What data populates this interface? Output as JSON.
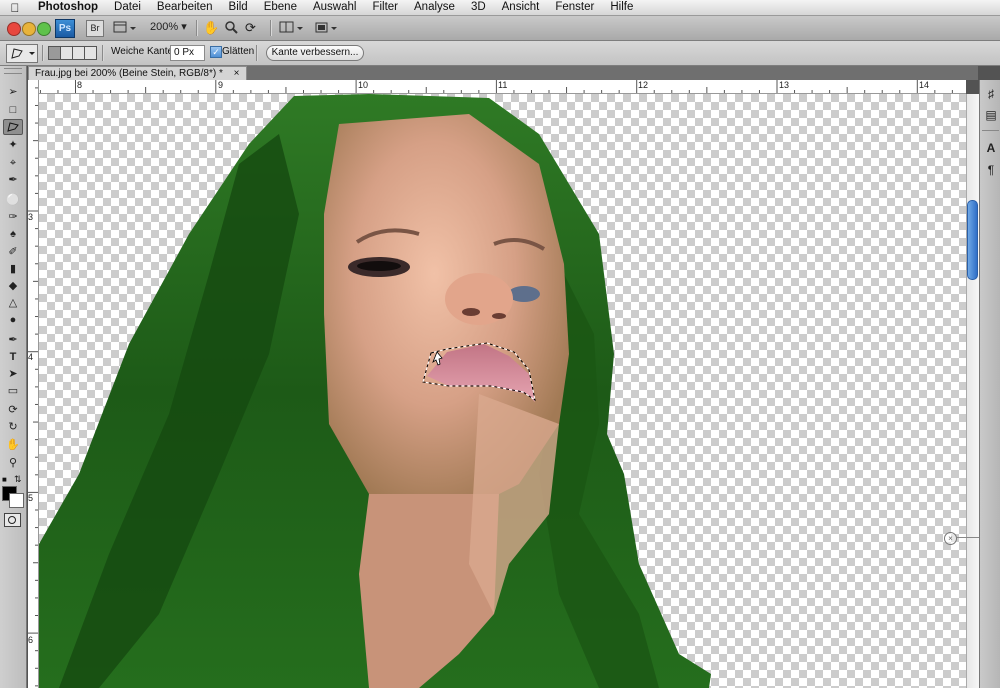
{
  "menubar": {
    "apple_icon": "apple-icon",
    "items": [
      "Photoshop",
      "Datei",
      "Bearbeiten",
      "Bild",
      "Ebene",
      "Auswahl",
      "Filter",
      "Analyse",
      "3D",
      "Ansicht",
      "Fenster",
      "Hilfe"
    ]
  },
  "appbar": {
    "ps_badge": "Ps",
    "br_badge": "Br",
    "zoom": "200%",
    "colors": {
      "close": "#e8473e",
      "minimize": "#e8b33a",
      "maximize": "#5fc24b"
    }
  },
  "options": {
    "feather_label": "Weiche Kante:",
    "feather_value": "0 Px",
    "antialias_label": "Glätten",
    "antialias_checked": true,
    "refine_label": "Kante verbessern..."
  },
  "document": {
    "tab_title": "Frau.jpg bei 200% (Beine Stein, RGB/8*) *",
    "close_glyph": "×"
  },
  "rulers": {
    "horizontal": [
      "8",
      "9",
      "10",
      "11",
      "12",
      "13",
      "14"
    ],
    "vertical": [
      "3",
      "4",
      "5",
      "6"
    ]
  },
  "toolbox": {
    "active_tool": "polygonal-lasso-tool"
  }
}
